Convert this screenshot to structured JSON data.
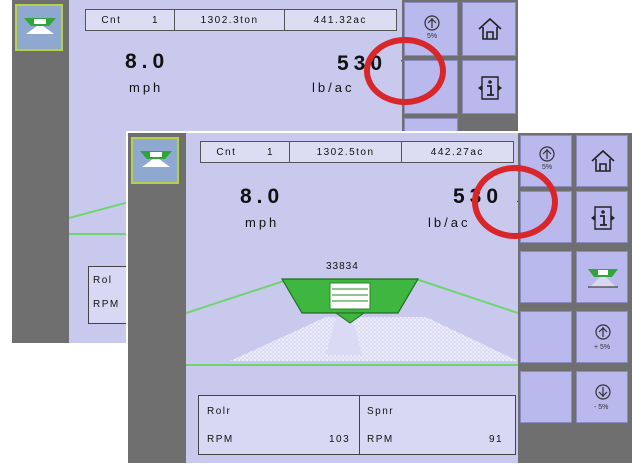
{
  "back_screen": {
    "status": {
      "cnt_label": "Cnt",
      "cnt_value": "1",
      "amount": "1302.3ton",
      "area": "441.32ac"
    },
    "speed": {
      "value": "8.0",
      "unit": "mph"
    },
    "rate": {
      "value": "530",
      "arrow": "↑",
      "unit": "lb/ac"
    },
    "panel": {
      "line1": "Rol",
      "line2": "RPM"
    },
    "side_buttons": [
      {
        "icon": "rate-percent-icon",
        "label": "5%"
      },
      {
        "icon": "home-icon"
      },
      {
        "icon": "blank"
      },
      {
        "icon": "info-icon"
      }
    ]
  },
  "front_screen": {
    "status": {
      "cnt_label": "Cnt",
      "cnt_value": "1",
      "amount": "1302.5ton",
      "area": "442.27ac"
    },
    "speed": {
      "value": "8.0",
      "unit": "mph"
    },
    "rate": {
      "value": "530",
      "arrow": "↓",
      "unit": "lb/ac"
    },
    "spreader_count": "33834",
    "roller": {
      "title": "Rolr",
      "label": "RPM",
      "value": "103"
    },
    "spinner": {
      "title": "Spnr",
      "label": "RPM",
      "value": "91"
    },
    "side_buttons": [
      {
        "icon": "rate-percent-icon",
        "label": "5%"
      },
      {
        "icon": "home-icon"
      },
      {
        "icon": "blank"
      },
      {
        "icon": "info-icon"
      },
      {
        "icon": "blank"
      },
      {
        "icon": "spreader-icon"
      },
      {
        "icon": "blank"
      },
      {
        "icon": "increase-rate-icon",
        "label": "+ 5%"
      },
      {
        "icon": "blank"
      },
      {
        "icon": "decrease-rate-icon",
        "label": "- 5%"
      }
    ]
  },
  "colors": {
    "screen_bg": "#c9c9ee",
    "bar_gray": "#6f6f6f",
    "button_bg": "#b9b9ee",
    "spreader_green": "#3fb63f",
    "guide_line": "#6fd46f",
    "highlight_circle": "#d9262a"
  }
}
